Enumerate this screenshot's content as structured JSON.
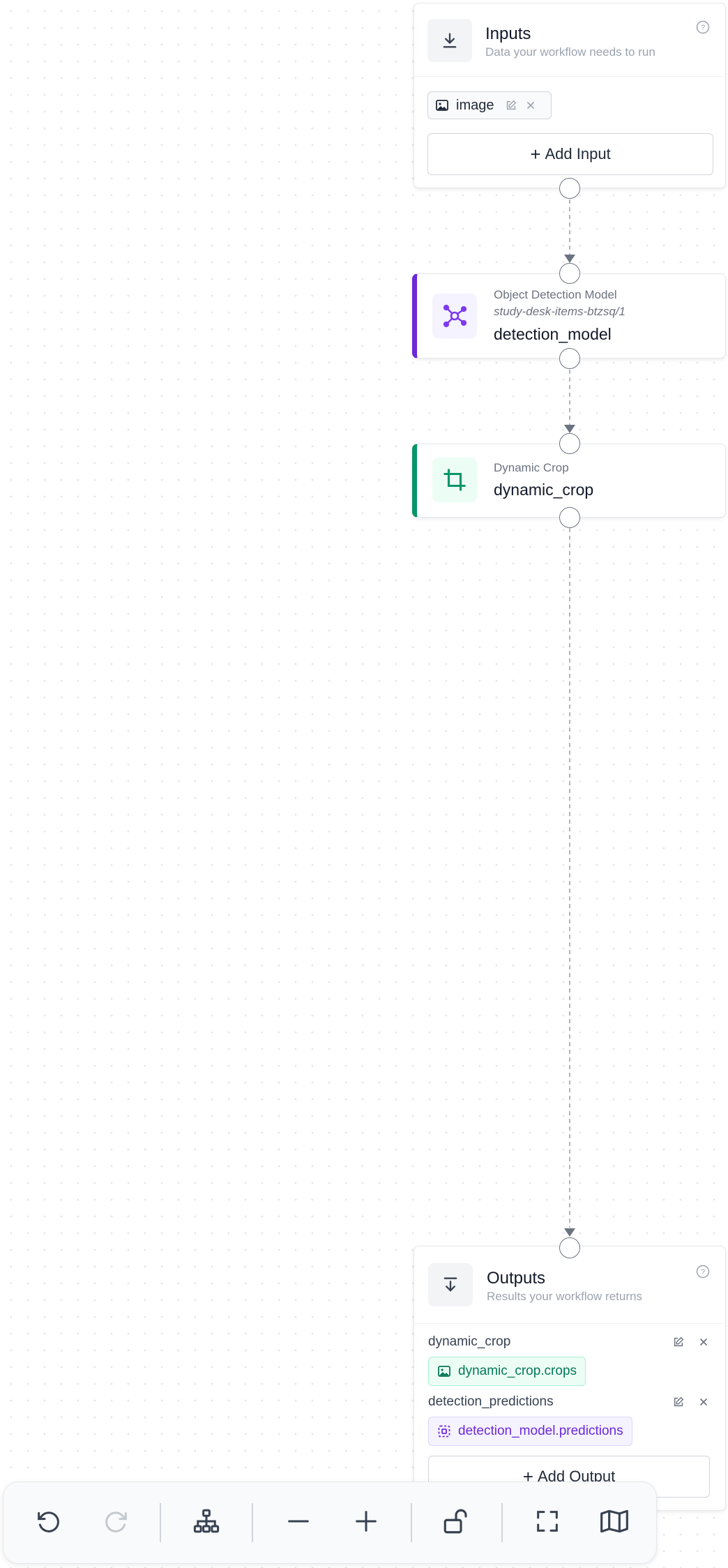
{
  "inputs": {
    "title": "Inputs",
    "subtitle": "Data your workflow needs to run",
    "items": [
      {
        "name": "image",
        "icon": "image-icon"
      }
    ],
    "add_button_label": "Add Input",
    "add_button_icon": "+"
  },
  "steps": [
    {
      "type": "Object Detection Model",
      "model_id": "study-desk-items-btzsq/1",
      "name": "detection_model",
      "accent": "#6d28d9",
      "icon": "network-icon"
    },
    {
      "type": "Dynamic Crop",
      "name": "dynamic_crop",
      "accent": "#059669",
      "icon": "crop-icon"
    }
  ],
  "outputs": {
    "title": "Outputs",
    "subtitle": "Results your workflow returns",
    "items": [
      {
        "name": "dynamic_crop",
        "selector": "dynamic_crop.crops",
        "color": "#047857",
        "icon": "image-icon"
      },
      {
        "name": "detection_predictions",
        "selector": "detection_model.predictions",
        "color": "#6d28d9",
        "icon": "bounding-box-icon"
      }
    ],
    "add_button_label": "Add Output",
    "add_button_icon": "+"
  },
  "toolbar": {
    "buttons": [
      "undo-icon",
      "redo-icon",
      "auto-layout-icon",
      "zoom-out-icon",
      "zoom-in-icon",
      "lock-icon",
      "fit-view-icon",
      "minimap-icon"
    ],
    "redo_enabled": false
  }
}
